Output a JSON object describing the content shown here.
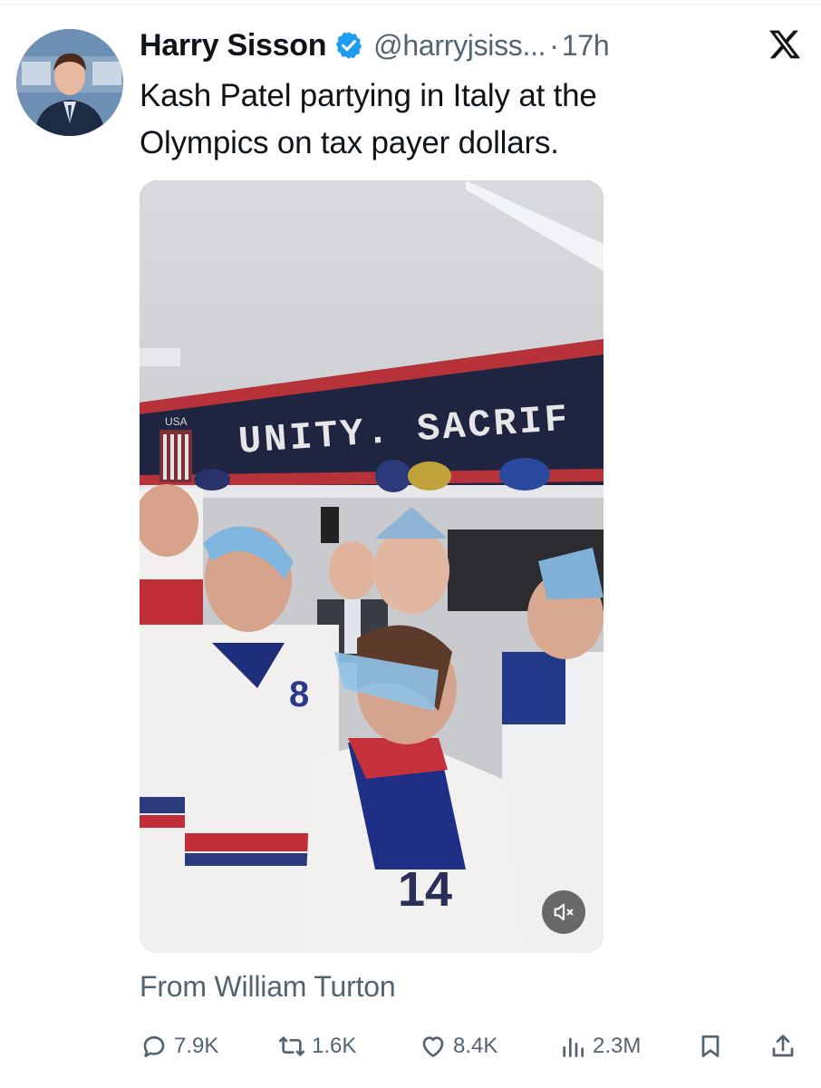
{
  "tweet": {
    "author_name": "Harry Sisson",
    "handle": "@harryjsiss...",
    "separator": "·",
    "time": "17h",
    "text_line1": "Kash Patel partying in Italy at the",
    "text_line2": "Olympics on tax payer dollars.",
    "media_banner": "UNITY. SACRIF",
    "media_small_label": "USA",
    "jersey_number_front": "14",
    "jersey_number_left": "8",
    "from_label": "From William Turton"
  },
  "actions": {
    "replies": "7.9K",
    "reposts": "1.6K",
    "likes": "8.4K",
    "views": "2.3M"
  },
  "icons": {
    "verified": "verified-badge-icon",
    "platform": "x-logo-icon",
    "mute": "muted-speaker-icon",
    "reply": "reply-bubble-icon",
    "repost": "repost-icon",
    "like": "heart-icon",
    "views": "views-bars-icon",
    "bookmark": "bookmark-icon",
    "share": "share-icon"
  },
  "colors": {
    "verified_blue": "#1d9bf0",
    "text_primary": "#0f1419",
    "text_secondary": "#536471"
  }
}
